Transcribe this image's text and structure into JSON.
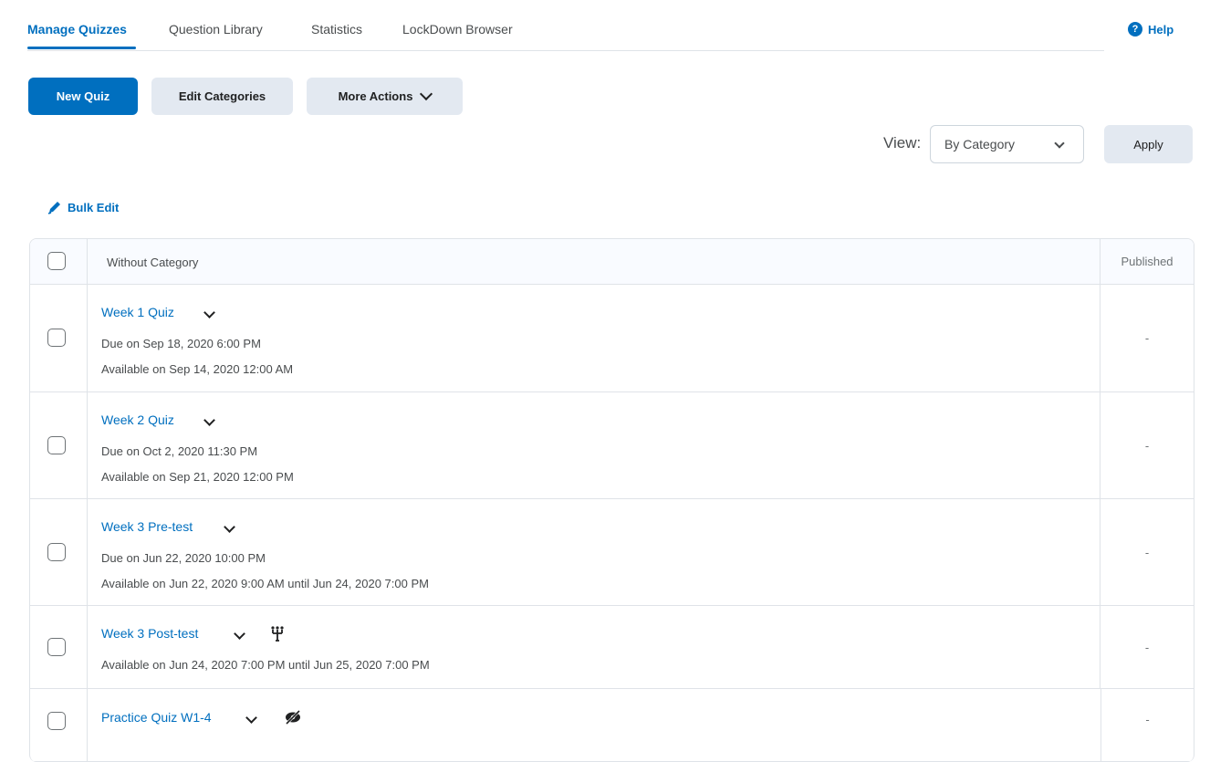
{
  "tabs": [
    {
      "label": "Manage Quizzes",
      "active": true
    },
    {
      "label": "Question Library"
    },
    {
      "label": "Statistics"
    },
    {
      "label": "LockDown Browser"
    }
  ],
  "help": {
    "label": "Help",
    "icon": "help-icon"
  },
  "toolbar": {
    "new_quiz": "New Quiz",
    "edit_categories": "Edit Categories",
    "more_actions": "More Actions"
  },
  "view": {
    "label": "View:",
    "selected": "By Category",
    "apply": "Apply"
  },
  "bulk_edit": {
    "label": "Bulk Edit",
    "icon": "pencil-icon"
  },
  "table": {
    "category_header": "Without Category",
    "published_header": "Published",
    "rows": [
      {
        "title": "Week 1 Quiz",
        "due": "Due on Sep 18, 2020 6:00 PM",
        "available": "Available on Sep 14, 2020 12:00 AM",
        "published": "-"
      },
      {
        "title": "Week 2 Quiz",
        "due": "Due on Oct 2, 2020 11:30 PM",
        "available": "Available on Sep 21, 2020 12:00 PM",
        "published": "-"
      },
      {
        "title": "Week 3 Pre-test",
        "due": "Due on Jun 22, 2020 10:00 PM",
        "available": "Available on Jun 22, 2020 9:00 AM until Jun 24, 2020 7:00 PM",
        "published": "-"
      },
      {
        "title": "Week 3 Post-test",
        "available": "Available on Jun 24, 2020 7:00 PM until Jun 25, 2020 7:00 PM",
        "published": "-",
        "icon": "release-conditions-icon"
      },
      {
        "title": "Practice Quiz W1-4",
        "published": "-",
        "icon": "hidden-icon"
      }
    ]
  },
  "colors": {
    "accent": "#006fbf",
    "secondary_button": "#e3e9f1",
    "border": "#dfe3e8"
  }
}
